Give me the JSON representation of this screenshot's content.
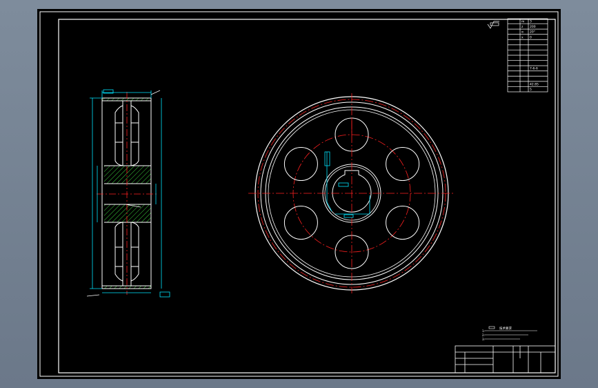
{
  "colors": {
    "background": "#000000",
    "outline": "#ffffff",
    "centerline": "#ff2020",
    "dimension": "#00e5ff",
    "hatch": "#3cd23c",
    "surround": "#75838f"
  },
  "param_table": {
    "rows": [
      [
        "",
        "m",
        "3"
      ],
      [
        "",
        "z",
        "200"
      ],
      [
        "",
        "α",
        "20°"
      ],
      [
        "",
        "x",
        "0"
      ],
      [
        "",
        "",
        ""
      ],
      [
        "",
        "",
        ""
      ],
      [
        "",
        "",
        ""
      ],
      [
        "",
        "",
        ""
      ],
      [
        "",
        "",
        ""
      ],
      [
        "",
        "",
        "7-6-6"
      ],
      [
        "",
        "",
        ""
      ],
      [
        "",
        "",
        ""
      ],
      [
        "",
        "",
        "42.85"
      ],
      [
        "",
        "",
        "5"
      ]
    ]
  },
  "notes": {
    "title": "技术要求",
    "lines": [
      "1.",
      "2.",
      "3."
    ]
  },
  "title_block": {
    "cells": [
      "",
      "",
      "",
      "",
      ""
    ]
  }
}
